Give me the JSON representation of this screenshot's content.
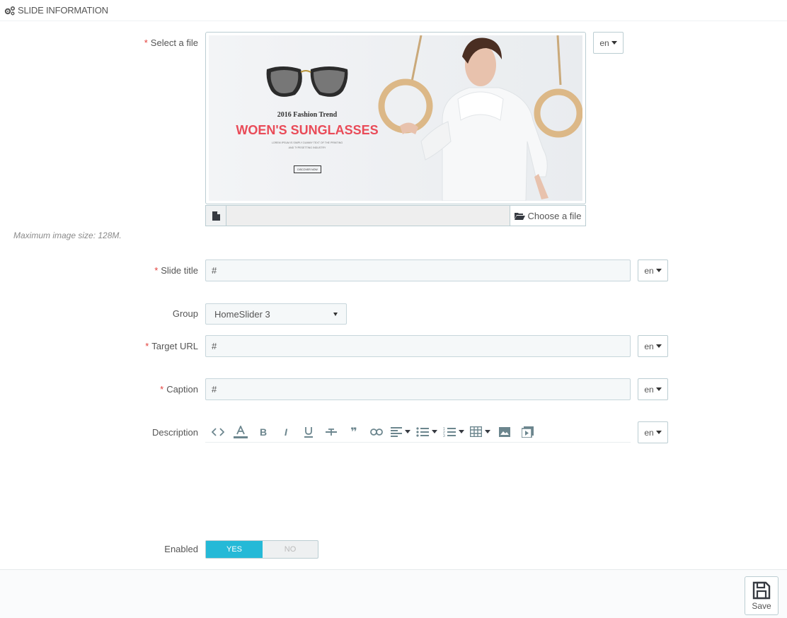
{
  "panel": {
    "title": "SLIDE INFORMATION"
  },
  "fields": {
    "file": {
      "label": "Select a file",
      "lang": "en",
      "choose_label": "Choose a file",
      "hint": "Maximum image size: 128M."
    },
    "title": {
      "label": "Slide title",
      "value": "#",
      "lang": "en"
    },
    "group": {
      "label": "Group",
      "value": "HomeSlider 3"
    },
    "url": {
      "label": "Target URL",
      "value": "#",
      "lang": "en"
    },
    "caption": {
      "label": "Caption",
      "value": "#",
      "lang": "en"
    },
    "description": {
      "label": "Description",
      "lang": "en"
    },
    "enabled": {
      "label": "Enabled",
      "yes": "YES",
      "no": "NO",
      "value": true
    }
  },
  "banner": {
    "headline_small": "2016 Fashion Trend",
    "headline": "WOEN'S SUNGLASSES",
    "body_line1": "LOREM IPSUM IS SIMPLY DUMMY TEXT OF THE PRINTING",
    "body_line2": "AND TYPESETTING INDUSTRY",
    "button": "DISCOVER NOW"
  },
  "toolbar": {
    "icons": [
      "code-icon",
      "font-color-icon",
      "bold-icon",
      "italic-icon",
      "underline-icon",
      "strikethrough-icon",
      "blockquote-icon",
      "link-icon",
      "align-icon",
      "bullet-list-icon",
      "numbered-list-icon",
      "table-icon",
      "image-icon",
      "video-icon"
    ]
  },
  "footer": {
    "save_label": "Save"
  },
  "colors": {
    "accent": "#25b9d7",
    "required": "#e3403b",
    "headline": "#e94b58"
  }
}
